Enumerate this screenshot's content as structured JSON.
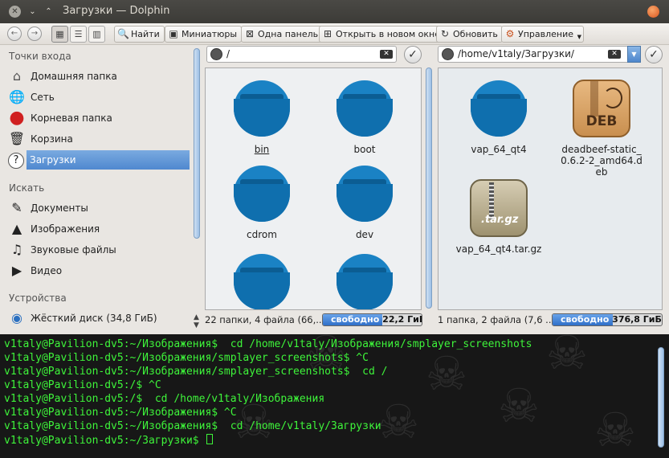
{
  "window": {
    "title": "Загрузки — Dolphin",
    "close_glyph": "✕",
    "min_glyph": "⌄",
    "max_glyph": "⌃"
  },
  "toolbar": {
    "back_glyph": "←",
    "forward_glyph": "→",
    "view_icons_glyph": "▦",
    "view_details_glyph": "☰",
    "view_columns_glyph": "▥",
    "find": "Найти",
    "find_glyph": "🔍",
    "preview": "Миниатюры",
    "preview_glyph": "▣",
    "split": "Одна панель",
    "split_glyph": "⊠",
    "open_tab": "Открыть в новом окне",
    "open_tab_glyph": "⊞",
    "reload": "Обновить",
    "reload_glyph": "↻",
    "manage": "Управление",
    "manage_glyph": "⚙"
  },
  "sidebar": {
    "places_title": "Точки входа",
    "places": [
      {
        "label": "Домашняя папка",
        "icon": "home-icon",
        "glyph": "⌂"
      },
      {
        "label": "Сеть",
        "icon": "network-icon",
        "glyph": "🌐"
      },
      {
        "label": "Корневая папка",
        "icon": "root-folder-icon",
        "glyph": "●"
      },
      {
        "label": "Корзина",
        "icon": "trash-icon",
        "glyph": "🗑"
      },
      {
        "label": "Загрузки",
        "icon": "downloads-icon",
        "glyph": "?"
      }
    ],
    "search_title": "Искать",
    "search": [
      {
        "label": "Документы",
        "icon": "documents-icon",
        "glyph": "✎"
      },
      {
        "label": "Изображения",
        "icon": "images-icon",
        "glyph": "▲"
      },
      {
        "label": "Звуковые файлы",
        "icon": "audio-icon",
        "glyph": "♫"
      },
      {
        "label": "Видео",
        "icon": "video-icon",
        "glyph": "▶"
      }
    ],
    "devices_title": "Устройства",
    "devices": [
      {
        "label": "Жёсткий диск (34,8 ГиБ)",
        "icon": "hard-disk-icon",
        "glyph": "◉"
      }
    ]
  },
  "left_pane": {
    "path": "/",
    "items": [
      "bin",
      "boot",
      "cdrom",
      "dev",
      "",
      ""
    ],
    "status": "22 папки, 4 файла (66,...",
    "free_label": "свободно",
    "free_value": "22,2 ГиБ",
    "used_fraction": 0.6
  },
  "right_pane": {
    "path": "/home/v1taly/Загрузки/",
    "items": [
      {
        "name": "vap_64_qt4",
        "kind": "folder"
      },
      {
        "name": "deadbeef-static_0.6.2-2_amd64.deb",
        "kind": "deb",
        "badge": "DEB"
      },
      {
        "name": "vap_64_qt4.tar.gz",
        "kind": "tgz",
        "badge": ".tar.gz"
      }
    ],
    "status": "1 папка, 2 файла (7,6 ...",
    "free_label": "свободно",
    "free_value": "376,8 ГиБ",
    "used_fraction": 0.55
  },
  "terminal": {
    "lines": [
      "v1taly@Pavilion-dv5:~/Изображения$  cd /home/v1taly/Изображения/smplayer_screenshots",
      "v1taly@Pavilion-dv5:~/Изображения/smplayer_screenshots$ ^C",
      "v1taly@Pavilion-dv5:~/Изображения/smplayer_screenshots$  cd /",
      "v1taly@Pavilion-dv5:/$ ^C",
      "v1taly@Pavilion-dv5:/$  cd /home/v1taly/Изображения",
      "v1taly@Pavilion-dv5:~/Изображения$ ^C",
      "v1taly@Pavilion-dv5:~/Изображения$  cd /home/v1taly/Загрузки",
      "v1taly@Pavilion-dv5:~/Загрузки$ "
    ],
    "text_color": "#3ef43a"
  },
  "colors": {
    "accent": "#4f88cf",
    "folder": "#1a82c4"
  }
}
